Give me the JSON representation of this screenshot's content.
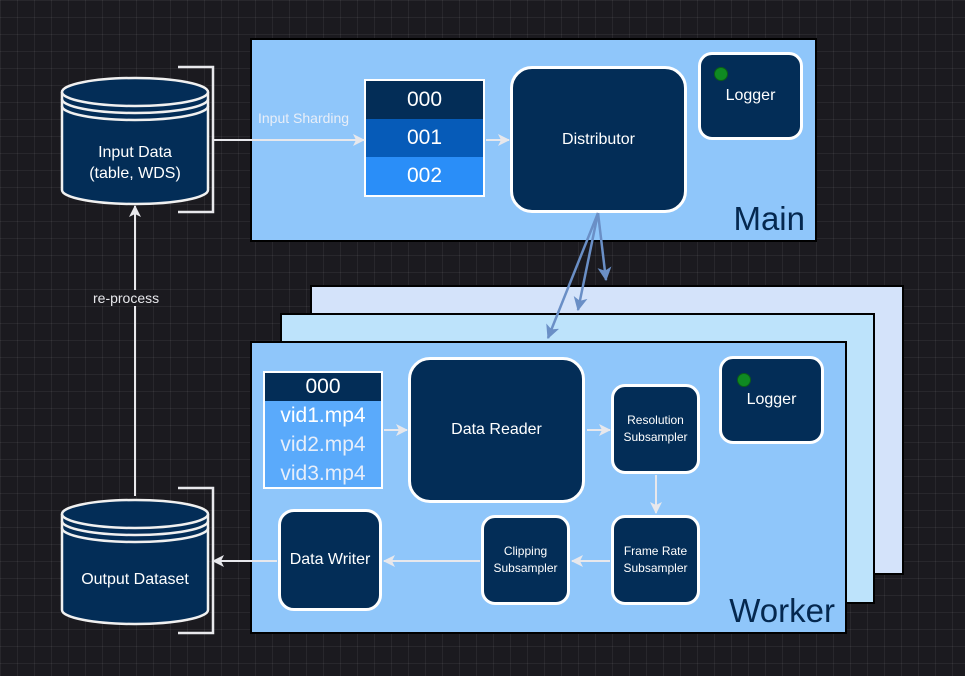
{
  "main": {
    "title": "Main",
    "input_label": "Input Sharding",
    "shards": [
      "000",
      "001",
      "002"
    ],
    "shard_colors": [
      "#032d57",
      "#065bb8",
      "#2a8ef8"
    ],
    "distributor": "Distributor",
    "logger": "Logger"
  },
  "storage": {
    "input_line1": "Input Data",
    "input_line2": "(table, WDS)",
    "output": "Output Dataset",
    "reprocess_label": "re-process"
  },
  "worker": {
    "title": "Worker",
    "shard_header": "000",
    "files": [
      "vid1.mp4",
      "vid2.mp4",
      "vid3.mp4"
    ],
    "data_reader": "Data Reader",
    "resolution_line1": "Resolution",
    "resolution_line2": "Subsampler",
    "frame_rate_line1": "Frame Rate",
    "frame_rate_line2": "Subsampler",
    "clipping_line1": "Clipping",
    "clipping_line2": "Subsampler",
    "data_writer": "Data Writer",
    "logger": "Logger"
  },
  "colors": {
    "node_fill": "#032d57",
    "panel_fill": "#8fc6fa",
    "status_led": "#0f8a22",
    "distribution_arrow": "#6a8fc6"
  }
}
